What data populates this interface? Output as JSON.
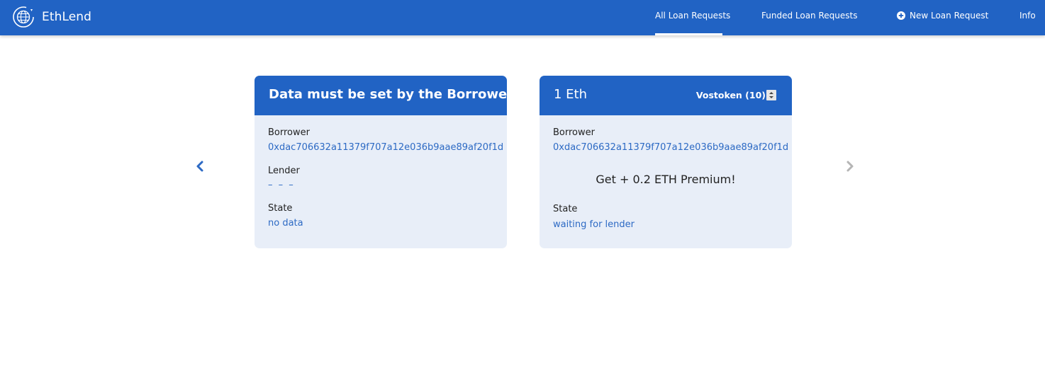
{
  "header": {
    "brand_name": "EthLend",
    "nav": {
      "all_loan_requests": "All Loan Requests",
      "funded_loan_requests": "Funded Loan Requests",
      "new_loan_request": "New Loan Request",
      "info": "Info"
    },
    "active_tab": "All Loan Requests"
  },
  "carousel": {
    "prev_icon": "chevron-left-icon",
    "next_icon": "chevron-right-icon"
  },
  "cards": [
    {
      "title": "Data must be set by the Borrower",
      "borrower_label": "Borrower",
      "borrower_value": "0xdac706632a11379f707a12e036b9aae89af20f1d",
      "lender_label": "Lender",
      "lender_value": "– – –",
      "state_label": "State",
      "state_value": "no data"
    },
    {
      "title": "1 Eth",
      "token_select": "Vostoken (10)",
      "borrower_label": "Borrower",
      "borrower_value": "0xdac706632a11379f707a12e036b9aae89af20f1d",
      "premium_text": "Get + 0.2 ETH Premium!",
      "state_label": "State",
      "state_value": "waiting for lender"
    }
  ],
  "colors": {
    "primary": "#2163c4",
    "card_body": "#e8eef8",
    "link": "#2d6ac4",
    "arrow_active": "#2d6ac4",
    "arrow_inactive": "#b5b5b5"
  }
}
